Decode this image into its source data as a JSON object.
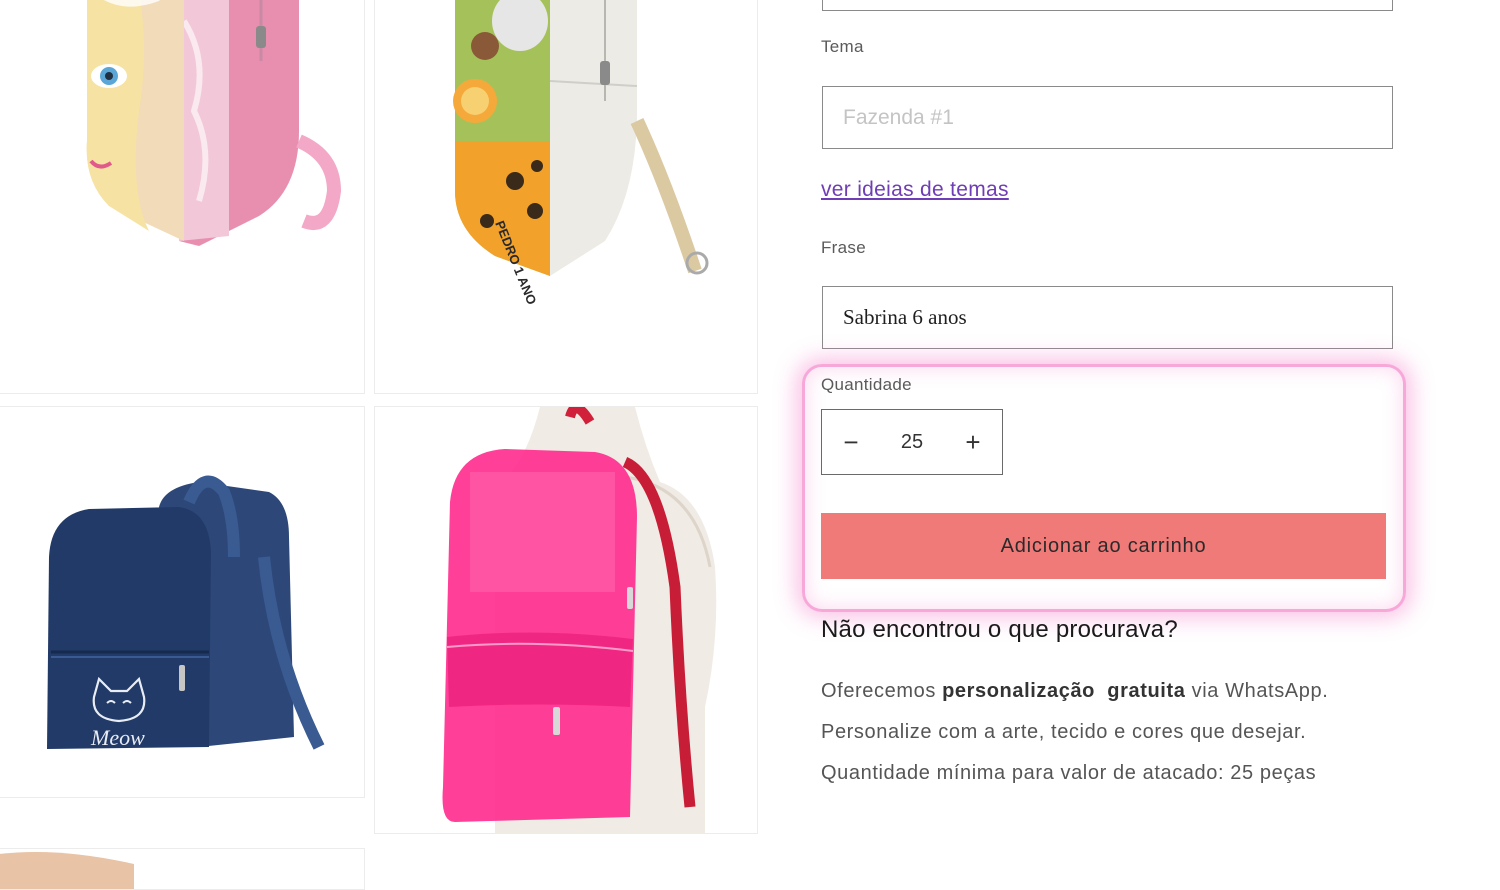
{
  "form": {
    "tema_label": "Tema",
    "tema_placeholder": "Fazenda #1",
    "ideas_link": "ver ideias de temas",
    "frase_label": "Frase",
    "frase_value": "Sabrina 6 anos",
    "quantity_label": "Quantidade",
    "quantity_value": "25",
    "minus_symbol": "−",
    "plus_symbol": "+",
    "add_to_cart": "Adicionar ao carrinho"
  },
  "info": {
    "heading": "Não encontrou o que procurava?",
    "line1_pre": "Oferecemos ",
    "line1_bold": "personalização  gratuita",
    "line1_post": " via WhatsApp.",
    "line2": "Personalize com a arte, tecido e cores que desejar.",
    "line3": "Quantidade mínima para valor de atacado: 25 peças"
  },
  "gallery": {
    "card2_text": "PEDRO 1 ANO",
    "card3_text": "Meow"
  },
  "colors": {
    "button": "#f07a78",
    "link": "#6f3db5",
    "highlight": "#f7a8d8"
  }
}
